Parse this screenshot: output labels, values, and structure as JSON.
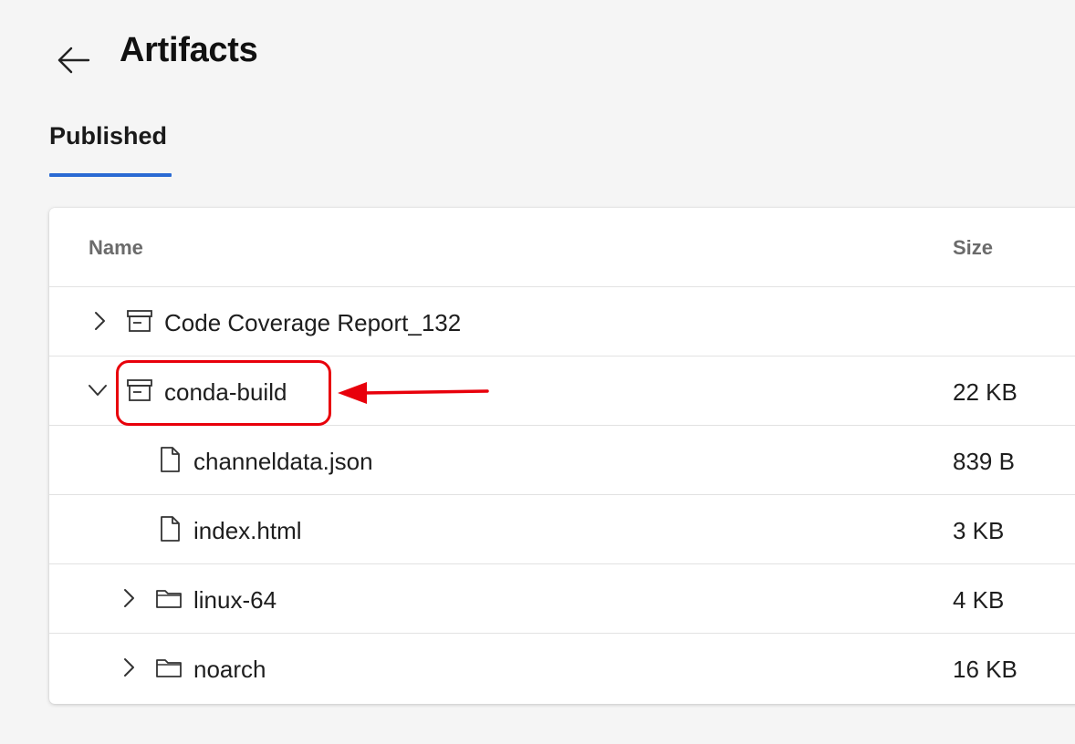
{
  "header": {
    "title": "Artifacts"
  },
  "tabs": [
    {
      "label": "Published",
      "selected": true
    }
  ],
  "table": {
    "columns": {
      "name": "Name",
      "size": "Size"
    },
    "rows": [
      {
        "name": "Code Coverage Report_132",
        "size": "",
        "type": "artifact",
        "expanded": false,
        "level": 0
      },
      {
        "name": "conda-build",
        "size": "22 KB",
        "type": "artifact",
        "expanded": true,
        "level": 0
      },
      {
        "name": "channeldata.json",
        "size": "839 B",
        "type": "file",
        "level": 1
      },
      {
        "name": "index.html",
        "size": "3 KB",
        "type": "file",
        "level": 1
      },
      {
        "name": "linux-64",
        "size": "4 KB",
        "type": "folder",
        "expanded": false,
        "level": 1
      },
      {
        "name": "noarch",
        "size": "16 KB",
        "type": "folder",
        "expanded": false,
        "level": 1
      }
    ]
  },
  "annotation": {
    "target": "conda-build",
    "color": "#e8000b"
  },
  "colors": {
    "accent": "#2a6ad3",
    "background": "#f5f5f5",
    "card": "#ffffff"
  },
  "icons": {
    "back": "arrow-left-icon",
    "artifact": "archive-box-icon",
    "file": "file-icon",
    "folder": "folder-icon",
    "collapsed": "chevron-right-icon",
    "expanded": "chevron-down-icon"
  }
}
